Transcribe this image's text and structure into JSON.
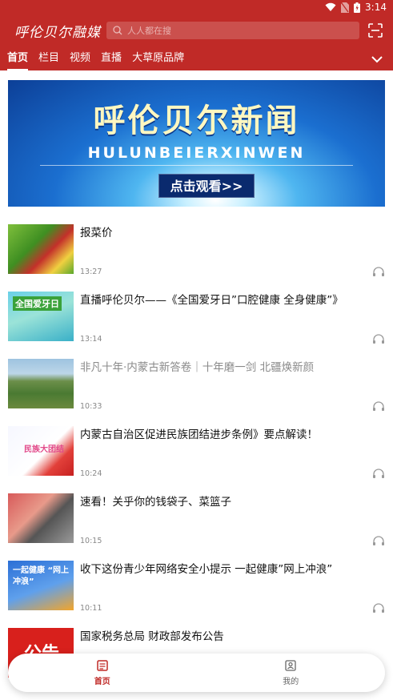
{
  "status_bar": {
    "time": "3:14"
  },
  "header": {
    "logo": "呼伦贝尔融媒",
    "search_placeholder": "人人都在搜",
    "tabs": [
      {
        "label": "首页",
        "active": true
      },
      {
        "label": "栏目",
        "active": false
      },
      {
        "label": "视频",
        "active": false
      },
      {
        "label": "直播",
        "active": false
      },
      {
        "label": "大草原品牌",
        "active": false
      }
    ]
  },
  "banner": {
    "title": "呼伦贝尔新闻",
    "subtitle": "HULUNBEIERXINWEN",
    "button": "点击观看>>"
  },
  "news": [
    {
      "title": "报菜价",
      "time": "13:27",
      "thumb": "t1",
      "thumb_text": "",
      "read": false
    },
    {
      "title": "直播呼伦贝尔——《全国爱牙日”口腔健康  全身健康”》",
      "time": "13:14",
      "thumb": "t2",
      "thumb_text": "全国爱牙日",
      "read": false
    },
    {
      "title": "非凡十年·内蒙古新答卷｜十年磨一剑 北疆焕新颜",
      "time": "10:33",
      "thumb": "t3",
      "thumb_text": "",
      "read": true
    },
    {
      "title": "内蒙古自治区促进民族团结进步条例》要点解读！",
      "time": "10:24",
      "thumb": "t4",
      "thumb_text": "民族大团结",
      "read": false
    },
    {
      "title": "速看！关乎你的钱袋子、菜篮子",
      "time": "10:15",
      "thumb": "t5",
      "thumb_text": "",
      "read": false
    },
    {
      "title": "收下这份青少年网络安全小提示 一起健康”网上冲浪”",
      "time": "10:11",
      "thumb": "t6",
      "thumb_text": "一起健康 “网上冲浪”",
      "read": false
    },
    {
      "title": "国家税务总局 财政部发布公告",
      "time": "",
      "thumb": "t7",
      "thumb_text": "公告",
      "read": false
    }
  ],
  "bottom_nav": [
    {
      "label": "首页",
      "icon": "home-news-icon",
      "active": true
    },
    {
      "label": "我的",
      "icon": "profile-icon",
      "active": false
    }
  ],
  "colors": {
    "brand": "#c02a27",
    "text": "#111111",
    "muted": "#888888"
  }
}
